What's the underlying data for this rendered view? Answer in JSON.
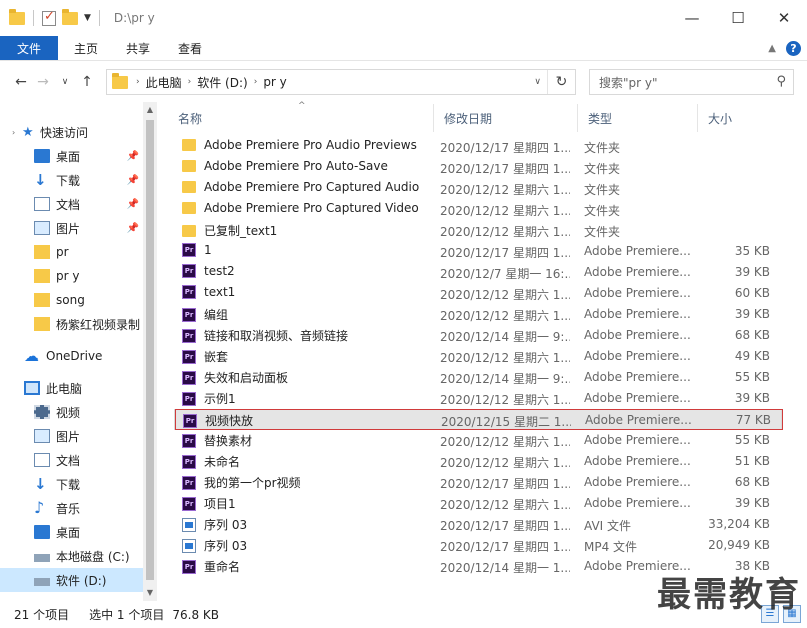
{
  "titlebar": {
    "path": "D:\\pr y",
    "minimize": "—",
    "maximize": "☐",
    "close": "✕"
  },
  "ribbon": {
    "tabs": [
      "文件",
      "主页",
      "共享",
      "查看"
    ],
    "help": "?"
  },
  "address": {
    "parts": [
      "此电脑",
      "软件 (D:)",
      "pr y"
    ],
    "search_placeholder": "搜索\"pr y\""
  },
  "nav": {
    "quick_access": "快速访问",
    "items": [
      {
        "label": "桌面",
        "icon": "desktop-icon",
        "pinned": true
      },
      {
        "label": "下载",
        "icon": "download-icon",
        "pinned": true
      },
      {
        "label": "文档",
        "icon": "document-icon",
        "pinned": true
      },
      {
        "label": "图片",
        "icon": "picture-icon",
        "pinned": true
      },
      {
        "label": "pr",
        "icon": "folder-icon",
        "pinned": false
      },
      {
        "label": "pr y",
        "icon": "folder-icon",
        "pinned": false
      },
      {
        "label": "song",
        "icon": "folder-icon",
        "pinned": false
      },
      {
        "label": "杨紫红视频录制",
        "icon": "folder-icon",
        "pinned": false
      }
    ],
    "onedrive": "OneDrive",
    "this_pc": "此电脑",
    "pc_items": [
      {
        "label": "视频",
        "icon": "video-icon"
      },
      {
        "label": "图片",
        "icon": "picture-icon"
      },
      {
        "label": "文档",
        "icon": "document-icon"
      },
      {
        "label": "下载",
        "icon": "download-icon"
      },
      {
        "label": "音乐",
        "icon": "music-icon"
      },
      {
        "label": "桌面",
        "icon": "desktop-icon"
      },
      {
        "label": "本地磁盘 (C:)",
        "icon": "drive-icon"
      },
      {
        "label": "软件 (D:)",
        "icon": "drive-icon"
      }
    ]
  },
  "columns": {
    "name": "名称",
    "date": "修改日期",
    "type": "类型",
    "size": "大小"
  },
  "files": [
    {
      "name": "Adobe Premiere Pro Audio Previews",
      "date": "2020/12/17 星期四 1...",
      "type": "文件夹",
      "size": "",
      "kind": "folder"
    },
    {
      "name": "Adobe Premiere Pro Auto-Save",
      "date": "2020/12/17 星期四 1...",
      "type": "文件夹",
      "size": "",
      "kind": "folder"
    },
    {
      "name": "Adobe Premiere Pro Captured Audio",
      "date": "2020/12/12 星期六 1...",
      "type": "文件夹",
      "size": "",
      "kind": "folder"
    },
    {
      "name": "Adobe Premiere Pro Captured Video",
      "date": "2020/12/12 星期六 1...",
      "type": "文件夹",
      "size": "",
      "kind": "folder"
    },
    {
      "name": "已复制_text1",
      "date": "2020/12/12 星期六 1...",
      "type": "文件夹",
      "size": "",
      "kind": "folder"
    },
    {
      "name": "1",
      "date": "2020/12/17 星期四 1...",
      "type": "Adobe Premiere...",
      "size": "35 KB",
      "kind": "pr"
    },
    {
      "name": "test2",
      "date": "2020/12/7 星期一 16:...",
      "type": "Adobe Premiere...",
      "size": "39 KB",
      "kind": "pr"
    },
    {
      "name": "text1",
      "date": "2020/12/12 星期六 1...",
      "type": "Adobe Premiere...",
      "size": "60 KB",
      "kind": "pr"
    },
    {
      "name": "编组",
      "date": "2020/12/12 星期六 1...",
      "type": "Adobe Premiere...",
      "size": "39 KB",
      "kind": "pr"
    },
    {
      "name": "链接和取消视频、音频链接",
      "date": "2020/12/14 星期一 9:...",
      "type": "Adobe Premiere...",
      "size": "68 KB",
      "kind": "pr"
    },
    {
      "name": "嵌套",
      "date": "2020/12/12 星期六 1...",
      "type": "Adobe Premiere...",
      "size": "49 KB",
      "kind": "pr"
    },
    {
      "name": "失效和启动面板",
      "date": "2020/12/14 星期一 9:...",
      "type": "Adobe Premiere...",
      "size": "55 KB",
      "kind": "pr"
    },
    {
      "name": "示例1",
      "date": "2020/12/12 星期六 1...",
      "type": "Adobe Premiere...",
      "size": "39 KB",
      "kind": "pr"
    },
    {
      "name": "视频快放",
      "date": "2020/12/15 星期二 1...",
      "type": "Adobe Premiere...",
      "size": "77 KB",
      "kind": "pr",
      "selected": true
    },
    {
      "name": "替换素材",
      "date": "2020/12/12 星期六 1...",
      "type": "Adobe Premiere...",
      "size": "55 KB",
      "kind": "pr"
    },
    {
      "name": "未命名",
      "date": "2020/12/12 星期六 1...",
      "type": "Adobe Premiere...",
      "size": "51 KB",
      "kind": "pr"
    },
    {
      "name": "我的第一个pr视频",
      "date": "2020/12/17 星期四 1...",
      "type": "Adobe Premiere...",
      "size": "68 KB",
      "kind": "pr"
    },
    {
      "name": "项目1",
      "date": "2020/12/12 星期六 1...",
      "type": "Adobe Premiere...",
      "size": "39 KB",
      "kind": "pr"
    },
    {
      "name": "序列 03",
      "date": "2020/12/17 星期四 1...",
      "type": "AVI 文件",
      "size": "33,204 KB",
      "kind": "avi"
    },
    {
      "name": "序列 03",
      "date": "2020/12/17 星期四 1...",
      "type": "MP4 文件",
      "size": "20,949 KB",
      "kind": "avi"
    },
    {
      "name": "重命名",
      "date": "2020/12/14 星期一 1...",
      "type": "Adobe Premiere...",
      "size": "38 KB",
      "kind": "pr"
    }
  ],
  "status": {
    "count": "21 个项目",
    "selected": "选中 1 个项目",
    "size": "76.8 KB"
  },
  "watermark": "最需教育"
}
